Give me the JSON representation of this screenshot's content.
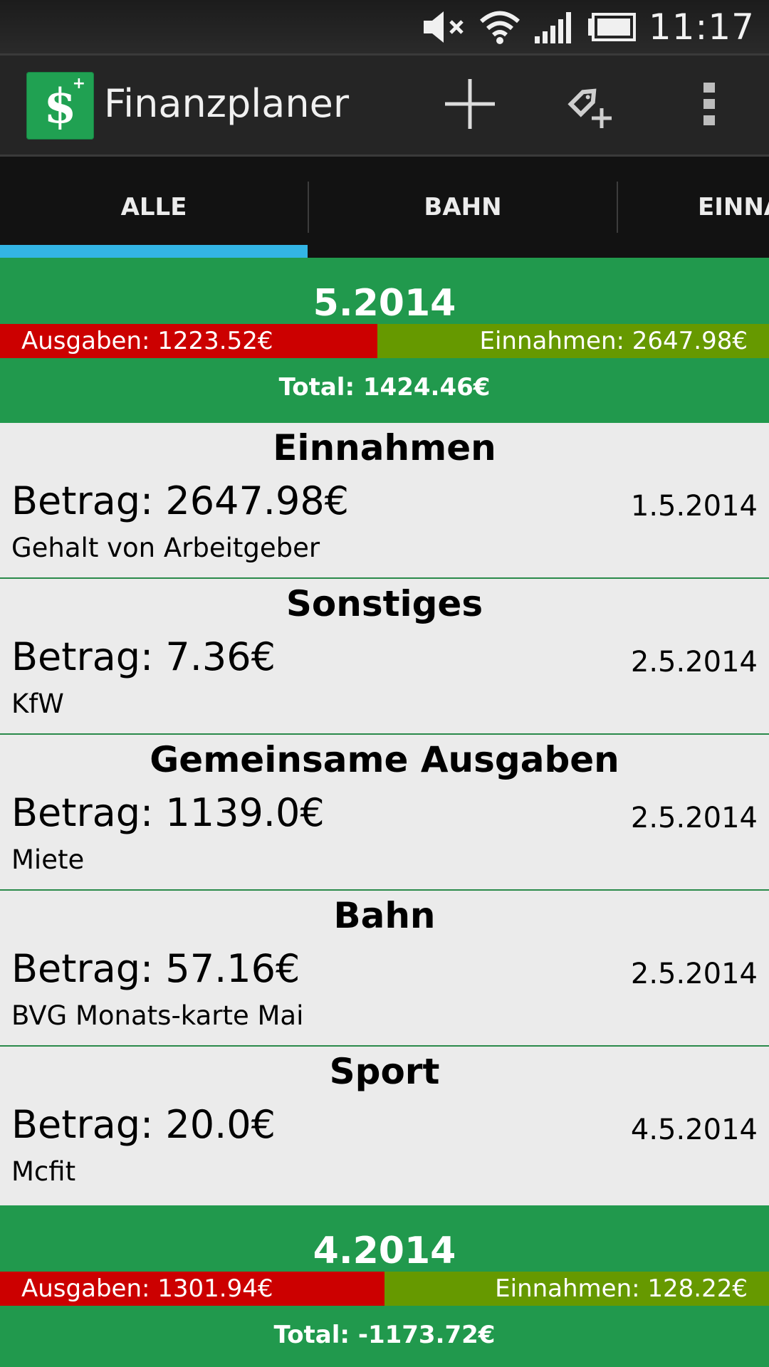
{
  "status_bar": {
    "time": "11:17",
    "icons": [
      "mute-icon",
      "wifi-icon",
      "signal-icon",
      "battery-icon"
    ]
  },
  "action_bar": {
    "app_title": "Finanzplaner",
    "logo_symbol": "$",
    "logo_plus": "+",
    "actions": [
      "add-icon",
      "add-tag-icon",
      "overflow-menu-icon"
    ]
  },
  "tabs": [
    {
      "label": "ALLE",
      "selected": true
    },
    {
      "label": "BAHN",
      "selected": false
    },
    {
      "label": "EINNA",
      "selected": false
    }
  ],
  "colors": {
    "header_green": "#21994d",
    "expense_red": "#cc0000",
    "income_green": "#669900",
    "tab_indicator": "#33b5e5"
  },
  "months": [
    {
      "title": "5.2014",
      "expenses": "Ausgaben: 1223.52€",
      "income": "Einnahmen: 2647.98€",
      "expense_share": 0.4,
      "total": "Total: 1424.46€",
      "entries": [
        {
          "category": "Einnahmen",
          "amount": "Betrag: 2647.98€",
          "date": "1.5.2014",
          "description": "Gehalt von Arbeitgeber"
        },
        {
          "category": "Sonstiges",
          "amount": "Betrag: 7.36€",
          "date": "2.5.2014",
          "description": "KfW"
        },
        {
          "category": "Gemeinsame Ausgaben",
          "amount": "Betrag: 1139.0€",
          "date": "2.5.2014",
          "description": "Miete"
        },
        {
          "category": "Bahn",
          "amount": "Betrag: 57.16€",
          "date": "2.5.2014",
          "description": "BVG Monats-karte Mai"
        },
        {
          "category": "Sport",
          "amount": "Betrag: 20.0€",
          "date": "4.5.2014",
          "description": "Mcfit"
        }
      ]
    },
    {
      "title": "4.2014",
      "expenses": "Ausgaben: 1301.94€",
      "income": "Einnahmen: 128.22€",
      "expense_share": 0.5,
      "total": "Total: -1173.72€",
      "entries": []
    }
  ]
}
